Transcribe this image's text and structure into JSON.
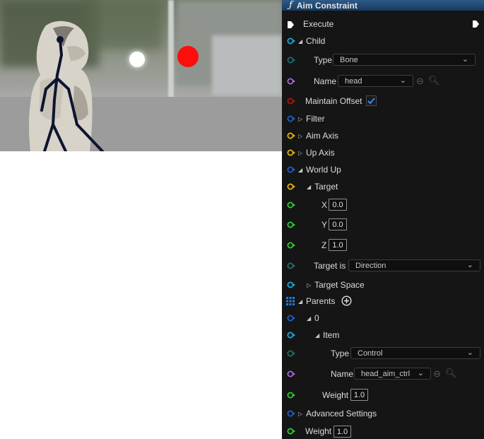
{
  "viewport": {
    "ball_colors": [
      "#ffffff",
      "#ff0d0d"
    ]
  },
  "panel": {
    "title": "Aim Constraint",
    "title_icon": "function-icon",
    "rows": {
      "execute": "Execute",
      "child": "Child",
      "child_type_label": "Type",
      "child_type_value": "Bone",
      "child_name_label": "Name",
      "child_name_value": "head",
      "maintain_offset": "Maintain Offset",
      "maintain_offset_checked": true,
      "filter": "Filter",
      "aim_axis": "Aim Axis",
      "up_axis": "Up Axis",
      "world_up": "World Up",
      "target": "Target",
      "x_label": "X",
      "x_value": "0.0",
      "y_label": "Y",
      "y_value": "0.0",
      "z_label": "Z",
      "z_value": "1.0",
      "target_is_label": "Target is",
      "target_is_value": "Direction",
      "target_space": "Target Space",
      "parents": "Parents",
      "index_0": "0",
      "item": "Item",
      "item_type_label": "Type",
      "item_type_value": "Control",
      "item_name_label": "Name",
      "item_name_value": "head_aim_ctrl",
      "item_weight_label": "Weight",
      "item_weight_value": "1.0",
      "advanced": "Advanced Settings",
      "weight_label": "Weight",
      "weight_value": "1.0"
    },
    "pin_colors": {
      "execute": "#ffffff",
      "struct": "#1ca8e0",
      "teal": "#1f6f66",
      "purple": "#a868d8",
      "bool": "#b01010",
      "blue": "#1d5fc8",
      "yellow": "#e2b40f",
      "green": "#2ecc2e",
      "array": "#1f7fe0"
    }
  }
}
